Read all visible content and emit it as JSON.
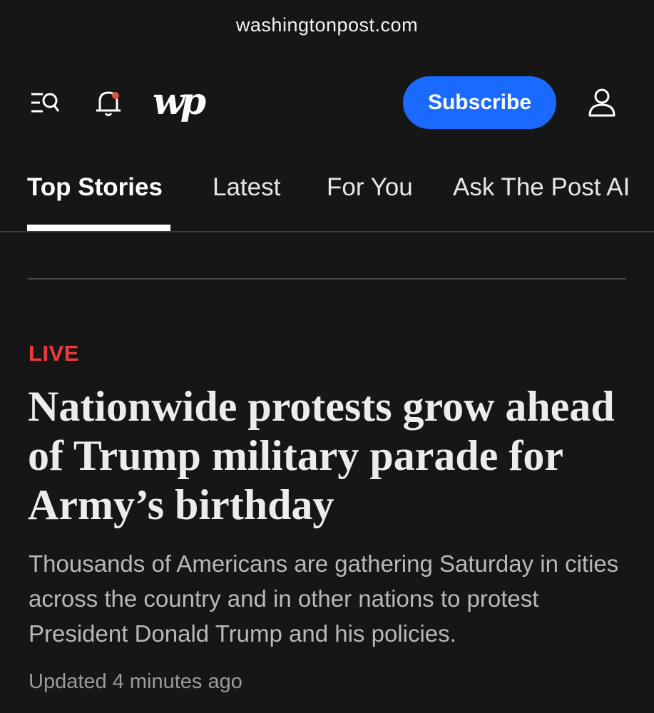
{
  "browser": {
    "url": "washingtonpost.com"
  },
  "header": {
    "menu_icon": "menu-search-icon",
    "bell_icon": "bell-icon",
    "notification_dot_color": "#d9573c",
    "logo_text": "wp",
    "subscribe_label": "Subscribe",
    "account_icon": "person-icon",
    "accent": "#1a6aff"
  },
  "tabs": [
    {
      "label": "Top Stories",
      "active": true
    },
    {
      "label": "Latest",
      "active": false
    },
    {
      "label": "For You",
      "active": false
    },
    {
      "label": "Ask The Post AI",
      "active": false
    }
  ],
  "story": {
    "label": "LIVE",
    "label_color": "#ee3a3a",
    "headline": "Nationwide protests grow ahead of Trump military parade for Army’s birthday",
    "summary": "Thousands of Americans are gathering Saturday in cities across the country and in  other nations to protest President Donald Trump and his policies.",
    "timestamp": "Updated 4 minutes ago"
  }
}
